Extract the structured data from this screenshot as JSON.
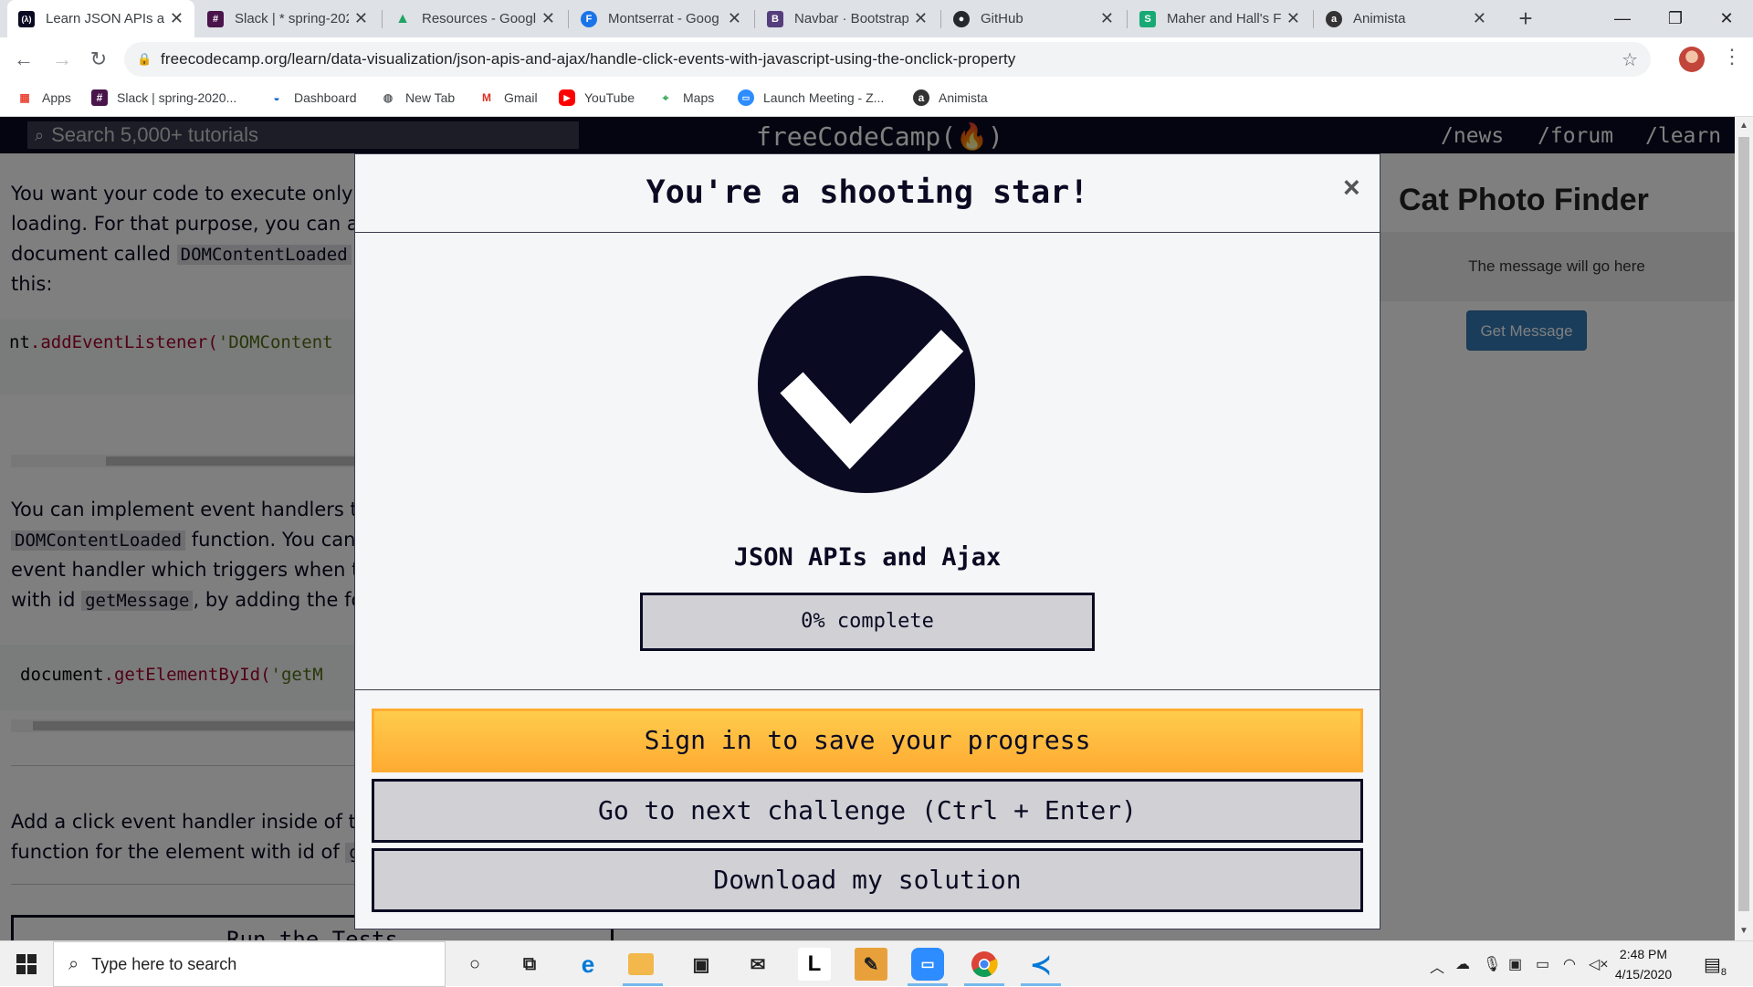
{
  "browser": {
    "tabs": [
      {
        "title": "Learn JSON APIs a",
        "icon": "freecodecamp-icon",
        "color": "#0a0a23",
        "glyph": "(λ)",
        "active": true
      },
      {
        "title": "Slack | * spring-202",
        "icon": "slack-icon",
        "color": "#4a154b",
        "glyph": "#"
      },
      {
        "title": "Resources - Googl",
        "icon": "google-drive-icon",
        "color": "#1fa463",
        "glyph": "▲"
      },
      {
        "title": "Montserrat - Goog",
        "icon": "google-fonts-icon",
        "color": "#1a73e8",
        "glyph": "F"
      },
      {
        "title": "Navbar · Bootstrap",
        "icon": "bootstrap-icon",
        "color": "#563d7c",
        "glyph": "B"
      },
      {
        "title": "GitHub",
        "icon": "github-icon",
        "color": "#24292e",
        "glyph": "●"
      },
      {
        "title": "Maher and Hall's F",
        "icon": "sheets-icon",
        "color": "#19a974",
        "glyph": "S"
      },
      {
        "title": "Animista",
        "icon": "animista-icon",
        "color": "#333333",
        "glyph": "a"
      }
    ],
    "url": "freecodecamp.org/learn/data-visualization/json-apis-and-ajax/handle-click-events-with-javascript-using-the-onclick-property",
    "bookmarks": [
      {
        "label": "Apps",
        "icon": "apps-grid-icon",
        "color": "#ea4335",
        "glyph": "⋮⋮"
      },
      {
        "label": "Slack | spring-2020...",
        "icon": "slack-icon",
        "color": "#4a154b",
        "glyph": "#"
      },
      {
        "label": "Dashboard",
        "icon": "dashboard-icon",
        "color": "#1565c0",
        "glyph": "◒"
      },
      {
        "label": "New Tab",
        "icon": "globe-icon",
        "color": "#5f6368",
        "glyph": "◍"
      },
      {
        "label": "Gmail",
        "icon": "gmail-icon",
        "color": "#d93025",
        "glyph": "M"
      },
      {
        "label": "YouTube",
        "icon": "youtube-icon",
        "color": "#ff0000",
        "glyph": "▶"
      },
      {
        "label": "Maps",
        "icon": "maps-icon",
        "color": "#34a853",
        "glyph": "⌖"
      },
      {
        "label": "Launch Meeting - Z...",
        "icon": "zoom-icon",
        "color": "#2d8cff",
        "glyph": "▭"
      },
      {
        "label": "Animista",
        "icon": "animista-icon",
        "color": "#333333",
        "glyph": "a"
      }
    ]
  },
  "fcc": {
    "search_placeholder": "Search 5,000+ tutorials",
    "brand": "freeCodeCamp(🔥)",
    "nav_links": [
      "/news",
      "/forum",
      "/learn"
    ]
  },
  "lesson": {
    "p1": [
      "You want your code to execute only on",
      "loading. For that purpose, you can atta",
      "this:"
    ],
    "p1_line3_prefix": "document called ",
    "p1_line3_code": "DOMContentLoaded",
    "code1_obj": "nt",
    "code1_fn": ".addEventListener(",
    "code1_str": "'DOMContent",
    "p2_line1": "You can implement event handlers tha",
    "p2_line2_code": "DOMContentLoaded",
    "p2_line2_rest": " function. You can",
    "p2_line3": "event handler which triggers when the",
    "p2_line4_prefix": "with id ",
    "p2_line4_code": "getMessage",
    "p2_line4_rest": ", by adding the fol",
    "code2_obj": "document",
    "code2_fn": ".getElementById(",
    "code2_str": "'getM",
    "p3_line1": "Add a click event handler inside of the",
    "p3_line2_prefix": "function for the element with id of ",
    "p3_line2_code": "get",
    "run_button": "Run the Tests"
  },
  "preview": {
    "title": "Cat Photo Finder",
    "message": "The message will go here",
    "button": "Get Message"
  },
  "modal": {
    "title": "You're a shooting star!",
    "close": "×",
    "course": "JSON APIs and Ajax",
    "progress_percent": 0,
    "progress_label": "0% complete",
    "sign_in": "Sign in to save your progress",
    "next": "Go to next challenge (Ctrl + Enter)",
    "download": "Download my solution"
  },
  "taskbar": {
    "search_placeholder": "Type here to search",
    "time": "2:48 PM",
    "date": "4/15/2020",
    "notifications": "8",
    "apps": [
      {
        "name": "cortana-icon",
        "glyph": "○",
        "color": "#222222"
      },
      {
        "name": "task-view-icon",
        "glyph": "⧉",
        "color": "#222222"
      },
      {
        "name": "edge-icon",
        "glyph": "e",
        "color": "#0078d7"
      },
      {
        "name": "file-explorer-icon",
        "glyph": "▬",
        "color": "#f2b84b"
      },
      {
        "name": "store-icon",
        "glyph": "🛍",
        "color": "#222222"
      },
      {
        "name": "mail-icon",
        "glyph": "✉",
        "color": "#222222"
      },
      {
        "name": "l-app-icon",
        "glyph": "L",
        "color": "#000000"
      },
      {
        "name": "paint-app-icon",
        "glyph": "✎",
        "color": "#e8a13a"
      },
      {
        "name": "zoom-icon",
        "glyph": "▭",
        "color": "#2d8cff"
      },
      {
        "name": "chrome-icon",
        "glyph": "◉",
        "color": "#db4437"
      },
      {
        "name": "vscode-icon",
        "glyph": "≺",
        "color": "#0078d7"
      }
    ]
  }
}
